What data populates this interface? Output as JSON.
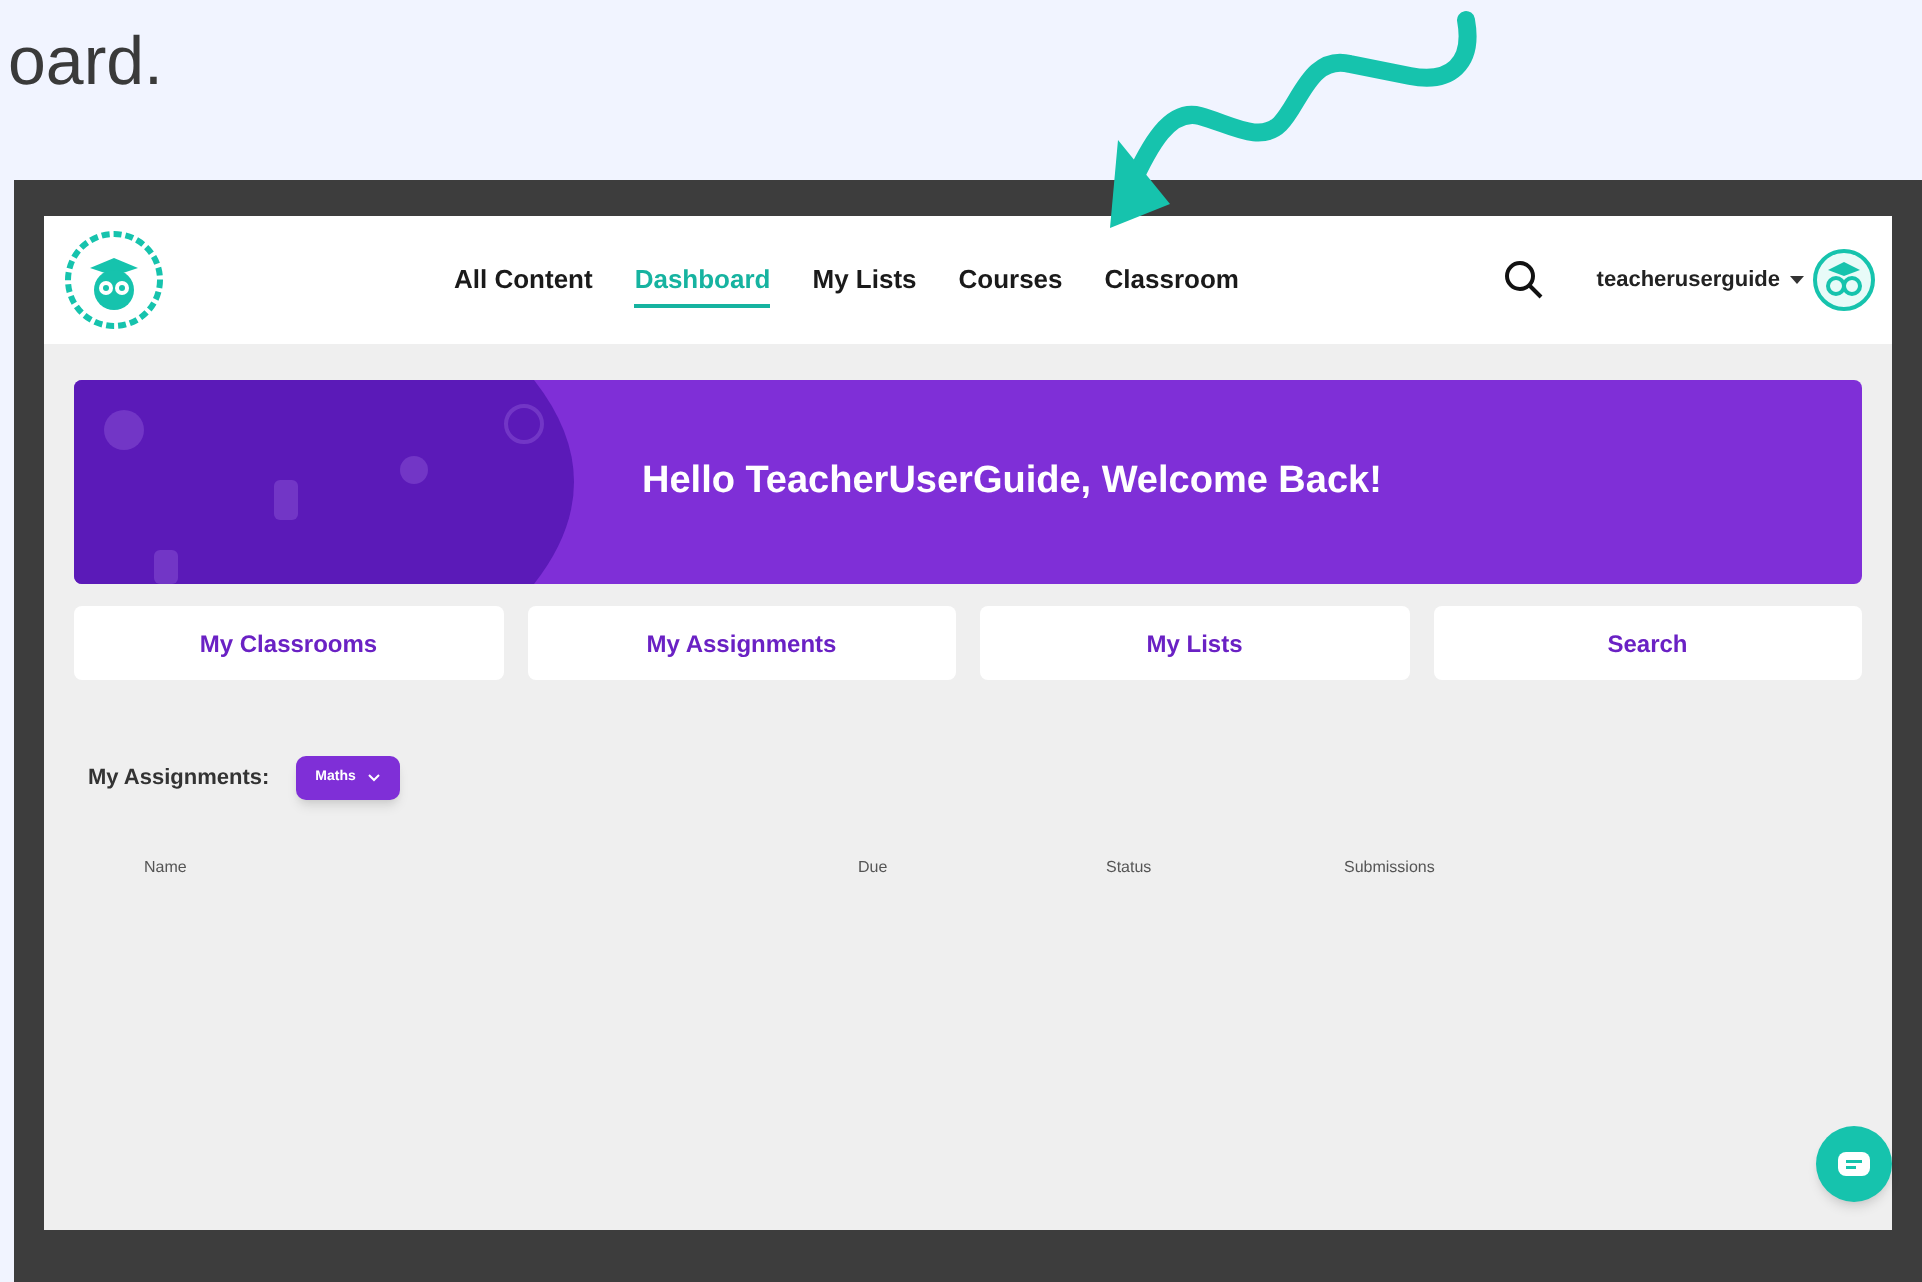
{
  "article_text": "oard.",
  "nav": {
    "items": [
      {
        "label": "All Content",
        "selected": false
      },
      {
        "label": "Dashboard",
        "selected": true
      },
      {
        "label": "My Lists",
        "selected": false
      },
      {
        "label": "Courses",
        "selected": false
      },
      {
        "label": "Classroom",
        "selected": false
      }
    ],
    "username": "teacheruserguide"
  },
  "banner": {
    "title": "Hello TeacherUserGuide, Welcome Back!"
  },
  "quick_links": [
    "My Classrooms",
    "My Assignments",
    "My Lists",
    "Search"
  ],
  "assignments": {
    "label": "My Assignments:",
    "subject": "Maths",
    "columns": [
      "Name",
      "Due",
      "Status",
      "Submissions"
    ]
  }
}
